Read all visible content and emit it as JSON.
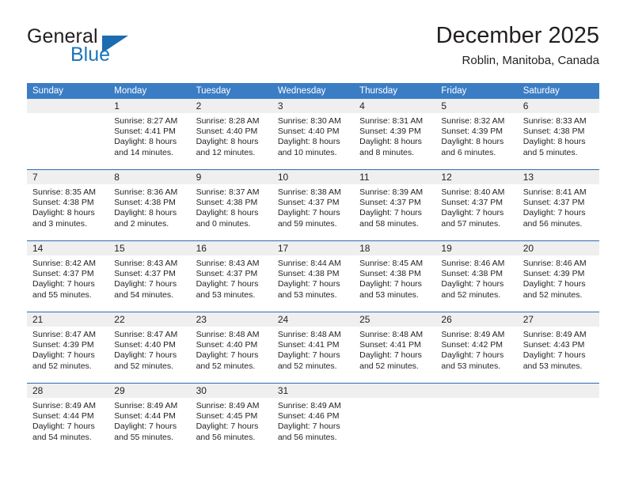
{
  "brand": {
    "word1": "General",
    "word2": "Blue",
    "triangle_color": "#1b6cb0",
    "blue_color": "#1b75bb"
  },
  "header": {
    "title": "December 2025",
    "subtitle": "Roblin, Manitoba, Canada"
  },
  "calendar": {
    "header_bg": "#3b7dc4",
    "daynum_bg": "#efefef",
    "weekdays": [
      "Sunday",
      "Monday",
      "Tuesday",
      "Wednesday",
      "Thursday",
      "Friday",
      "Saturday"
    ],
    "weeks": [
      [
        {
          "day": "",
          "sunrise": "",
          "sunset": "",
          "daylight": ""
        },
        {
          "day": "1",
          "sunrise": "Sunrise: 8:27 AM",
          "sunset": "Sunset: 4:41 PM",
          "daylight": "Daylight: 8 hours and 14 minutes."
        },
        {
          "day": "2",
          "sunrise": "Sunrise: 8:28 AM",
          "sunset": "Sunset: 4:40 PM",
          "daylight": "Daylight: 8 hours and 12 minutes."
        },
        {
          "day": "3",
          "sunrise": "Sunrise: 8:30 AM",
          "sunset": "Sunset: 4:40 PM",
          "daylight": "Daylight: 8 hours and 10 minutes."
        },
        {
          "day": "4",
          "sunrise": "Sunrise: 8:31 AM",
          "sunset": "Sunset: 4:39 PM",
          "daylight": "Daylight: 8 hours and 8 minutes."
        },
        {
          "day": "5",
          "sunrise": "Sunrise: 8:32 AM",
          "sunset": "Sunset: 4:39 PM",
          "daylight": "Daylight: 8 hours and 6 minutes."
        },
        {
          "day": "6",
          "sunrise": "Sunrise: 8:33 AM",
          "sunset": "Sunset: 4:38 PM",
          "daylight": "Daylight: 8 hours and 5 minutes."
        }
      ],
      [
        {
          "day": "7",
          "sunrise": "Sunrise: 8:35 AM",
          "sunset": "Sunset: 4:38 PM",
          "daylight": "Daylight: 8 hours and 3 minutes."
        },
        {
          "day": "8",
          "sunrise": "Sunrise: 8:36 AM",
          "sunset": "Sunset: 4:38 PM",
          "daylight": "Daylight: 8 hours and 2 minutes."
        },
        {
          "day": "9",
          "sunrise": "Sunrise: 8:37 AM",
          "sunset": "Sunset: 4:38 PM",
          "daylight": "Daylight: 8 hours and 0 minutes."
        },
        {
          "day": "10",
          "sunrise": "Sunrise: 8:38 AM",
          "sunset": "Sunset: 4:37 PM",
          "daylight": "Daylight: 7 hours and 59 minutes."
        },
        {
          "day": "11",
          "sunrise": "Sunrise: 8:39 AM",
          "sunset": "Sunset: 4:37 PM",
          "daylight": "Daylight: 7 hours and 58 minutes."
        },
        {
          "day": "12",
          "sunrise": "Sunrise: 8:40 AM",
          "sunset": "Sunset: 4:37 PM",
          "daylight": "Daylight: 7 hours and 57 minutes."
        },
        {
          "day": "13",
          "sunrise": "Sunrise: 8:41 AM",
          "sunset": "Sunset: 4:37 PM",
          "daylight": "Daylight: 7 hours and 56 minutes."
        }
      ],
      [
        {
          "day": "14",
          "sunrise": "Sunrise: 8:42 AM",
          "sunset": "Sunset: 4:37 PM",
          "daylight": "Daylight: 7 hours and 55 minutes."
        },
        {
          "day": "15",
          "sunrise": "Sunrise: 8:43 AM",
          "sunset": "Sunset: 4:37 PM",
          "daylight": "Daylight: 7 hours and 54 minutes."
        },
        {
          "day": "16",
          "sunrise": "Sunrise: 8:43 AM",
          "sunset": "Sunset: 4:37 PM",
          "daylight": "Daylight: 7 hours and 53 minutes."
        },
        {
          "day": "17",
          "sunrise": "Sunrise: 8:44 AM",
          "sunset": "Sunset: 4:38 PM",
          "daylight": "Daylight: 7 hours and 53 minutes."
        },
        {
          "day": "18",
          "sunrise": "Sunrise: 8:45 AM",
          "sunset": "Sunset: 4:38 PM",
          "daylight": "Daylight: 7 hours and 53 minutes."
        },
        {
          "day": "19",
          "sunrise": "Sunrise: 8:46 AM",
          "sunset": "Sunset: 4:38 PM",
          "daylight": "Daylight: 7 hours and 52 minutes."
        },
        {
          "day": "20",
          "sunrise": "Sunrise: 8:46 AM",
          "sunset": "Sunset: 4:39 PM",
          "daylight": "Daylight: 7 hours and 52 minutes."
        }
      ],
      [
        {
          "day": "21",
          "sunrise": "Sunrise: 8:47 AM",
          "sunset": "Sunset: 4:39 PM",
          "daylight": "Daylight: 7 hours and 52 minutes."
        },
        {
          "day": "22",
          "sunrise": "Sunrise: 8:47 AM",
          "sunset": "Sunset: 4:40 PM",
          "daylight": "Daylight: 7 hours and 52 minutes."
        },
        {
          "day": "23",
          "sunrise": "Sunrise: 8:48 AM",
          "sunset": "Sunset: 4:40 PM",
          "daylight": "Daylight: 7 hours and 52 minutes."
        },
        {
          "day": "24",
          "sunrise": "Sunrise: 8:48 AM",
          "sunset": "Sunset: 4:41 PM",
          "daylight": "Daylight: 7 hours and 52 minutes."
        },
        {
          "day": "25",
          "sunrise": "Sunrise: 8:48 AM",
          "sunset": "Sunset: 4:41 PM",
          "daylight": "Daylight: 7 hours and 52 minutes."
        },
        {
          "day": "26",
          "sunrise": "Sunrise: 8:49 AM",
          "sunset": "Sunset: 4:42 PM",
          "daylight": "Daylight: 7 hours and 53 minutes."
        },
        {
          "day": "27",
          "sunrise": "Sunrise: 8:49 AM",
          "sunset": "Sunset: 4:43 PM",
          "daylight": "Daylight: 7 hours and 53 minutes."
        }
      ],
      [
        {
          "day": "28",
          "sunrise": "Sunrise: 8:49 AM",
          "sunset": "Sunset: 4:44 PM",
          "daylight": "Daylight: 7 hours and 54 minutes."
        },
        {
          "day": "29",
          "sunrise": "Sunrise: 8:49 AM",
          "sunset": "Sunset: 4:44 PM",
          "daylight": "Daylight: 7 hours and 55 minutes."
        },
        {
          "day": "30",
          "sunrise": "Sunrise: 8:49 AM",
          "sunset": "Sunset: 4:45 PM",
          "daylight": "Daylight: 7 hours and 56 minutes."
        },
        {
          "day": "31",
          "sunrise": "Sunrise: 8:49 AM",
          "sunset": "Sunset: 4:46 PM",
          "daylight": "Daylight: 7 hours and 56 minutes."
        },
        {
          "day": "",
          "sunrise": "",
          "sunset": "",
          "daylight": ""
        },
        {
          "day": "",
          "sunrise": "",
          "sunset": "",
          "daylight": ""
        },
        {
          "day": "",
          "sunrise": "",
          "sunset": "",
          "daylight": ""
        }
      ]
    ]
  }
}
